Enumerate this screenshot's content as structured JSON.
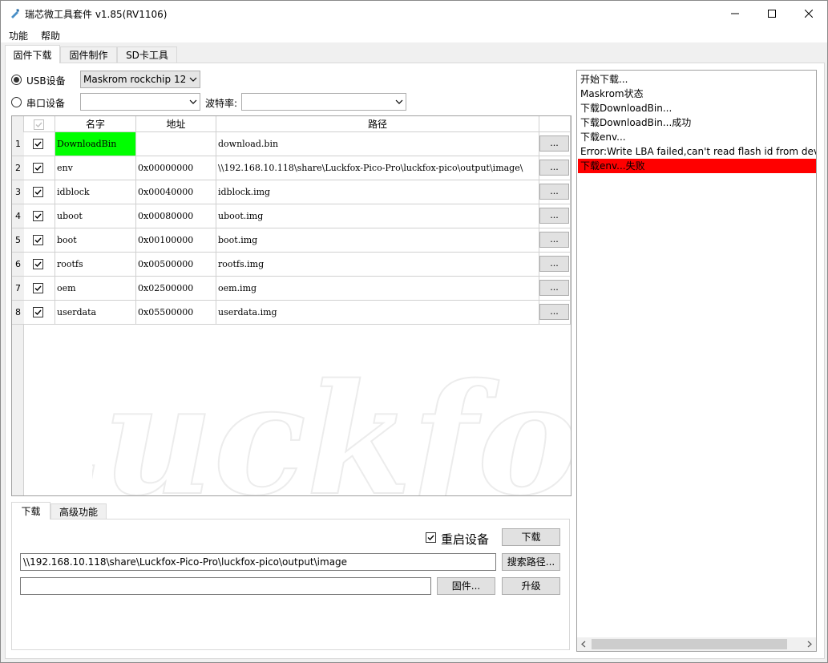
{
  "window": {
    "title": "瑞芯微工具套件 v1.85(RV1106)"
  },
  "menu": [
    "功能",
    "帮助"
  ],
  "tabs": [
    "固件下载",
    "固件制作",
    "SD卡工具"
  ],
  "device": {
    "usb_label": "USB设备",
    "usb_selected": "Maskrom rockchip 12",
    "serial_label": "串口设备",
    "serial_selected": "",
    "baud_label": "波特率:",
    "baud_selected": ""
  },
  "table": {
    "headers": [
      "名字",
      "地址",
      "路径"
    ],
    "browse_label": "...",
    "rows": [
      {
        "num": "1",
        "name": "DownloadBin",
        "addr": "",
        "path": "download.bin",
        "checked": true,
        "highlight": true
      },
      {
        "num": "2",
        "name": "env",
        "addr": "0x00000000",
        "path": "\\\\192.168.10.118\\share\\Luckfox-Pico-Pro\\luckfox-pico\\output\\image\\",
        "checked": true
      },
      {
        "num": "3",
        "name": "idblock",
        "addr": "0x00040000",
        "path": "idblock.img",
        "checked": true
      },
      {
        "num": "4",
        "name": "uboot",
        "addr": "0x00080000",
        "path": "uboot.img",
        "checked": true
      },
      {
        "num": "5",
        "name": "boot",
        "addr": "0x00100000",
        "path": "boot.img",
        "checked": true
      },
      {
        "num": "6",
        "name": "rootfs",
        "addr": "0x00500000",
        "path": "rootfs.img",
        "checked": true
      },
      {
        "num": "7",
        "name": "oem",
        "addr": "0x02500000",
        "path": "oem.img",
        "checked": true
      },
      {
        "num": "8",
        "name": "userdata",
        "addr": "0x05500000",
        "path": "userdata.img",
        "checked": true
      }
    ]
  },
  "bottom": {
    "tabs": [
      "下载",
      "高级功能"
    ],
    "reboot_label": "重启设备",
    "reboot_checked": true,
    "download_button": "下载",
    "search_path_button": "搜索路径...",
    "path_value": "\\\\192.168.10.118\\share\\Luckfox-Pico-Pro\\luckfox-pico\\output\\image",
    "firmware_value": "",
    "firmware_button": "固件...",
    "upgrade_button": "升级"
  },
  "log": [
    {
      "text": "开始下载...",
      "error": false
    },
    {
      "text": "Maskrom状态",
      "error": false
    },
    {
      "text": "下载DownloadBin...",
      "error": false
    },
    {
      "text": "下载DownloadBin...成功",
      "error": false
    },
    {
      "text": "下载env...",
      "error": false
    },
    {
      "text": "Error:Write LBA failed,can't read flash id from devi",
      "error": false
    },
    {
      "text": "下载env...失败",
      "error": true
    }
  ],
  "watermark": "Luckfox",
  "colors": {
    "highlight": "#00ff00",
    "error": "#ff0000"
  }
}
